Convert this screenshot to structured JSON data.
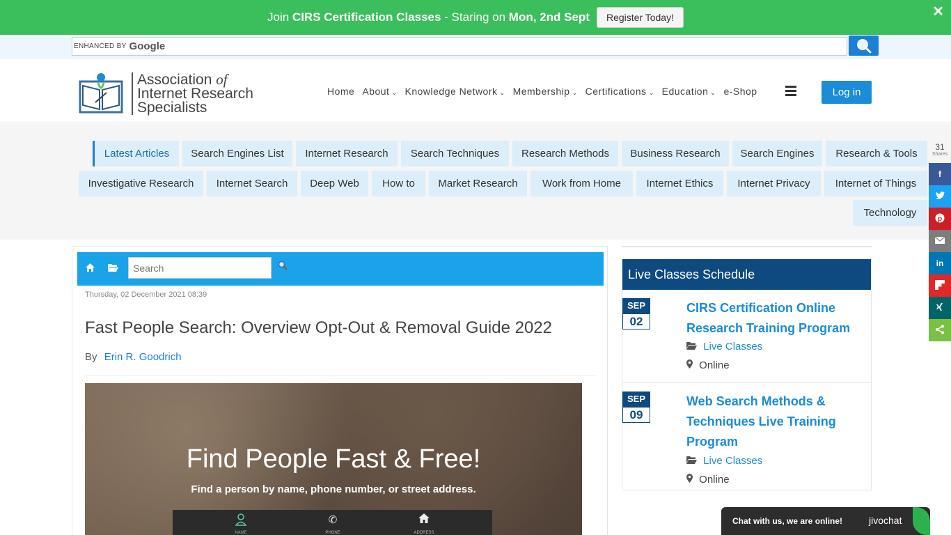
{
  "promo": {
    "prefix": "Join",
    "course": "CIRS Certification Classes",
    "mid": "- Staring on",
    "date": "Mon, 2nd Sept",
    "button": "Register Today!",
    "close": "✕"
  },
  "gsearch": {
    "enhanced": "ENHANCED BY",
    "brand": "Google"
  },
  "logo": {
    "line1a": "Association",
    "line1b": "of",
    "line2": "Internet Research",
    "line3": "Specialists"
  },
  "nav": {
    "items": [
      "Home",
      "About",
      "Knowledge Network",
      "Membership",
      "Certifications",
      "Education",
      "e-Shop"
    ],
    "login": "Log in"
  },
  "tags": [
    "Latest Articles",
    "Search Engines List",
    "Internet Research",
    "Search Techniques",
    "Research Methods",
    "Business Research",
    "Search Engines",
    "Research & Tools",
    "Investigative Research",
    "Internet Search",
    "Deep Web",
    "How to",
    "Market Research",
    "Work from Home",
    "Internet Ethics",
    "Internet Privacy",
    "Internet of Things",
    "Technology"
  ],
  "share": {
    "count": "31",
    "label": "Shares",
    "buttons": [
      {
        "name": "facebook",
        "glyph": "f",
        "color": "#3b5998"
      },
      {
        "name": "twitter",
        "glyph": "t",
        "color": "#1da1f2"
      },
      {
        "name": "pinterest",
        "glyph": "P",
        "color": "#cb2027"
      },
      {
        "name": "email",
        "glyph": "✉",
        "color": "#7d7d7d"
      },
      {
        "name": "linkedin",
        "glyph": "in",
        "color": "#0077b5"
      },
      {
        "name": "flipboard",
        "glyph": "F",
        "color": "#e12828"
      },
      {
        "name": "xing",
        "glyph": "X",
        "color": "#026466"
      },
      {
        "name": "share",
        "glyph": "<",
        "color": "#7ac143"
      }
    ]
  },
  "article": {
    "search_placeholder": "Search",
    "date": "Thursday, 02 December 2021 08:39",
    "title": "Fast People Search: Overview Opt-Out & Removal Guide 2022",
    "by": "By",
    "author": "Erin R. Goodrich",
    "hero": {
      "headline": "Find People Fast & Free!",
      "sub": "Find a person by name, phone number, or street address.",
      "tabs": [
        "NAME",
        "PHONE",
        "ADDRESS"
      ]
    }
  },
  "schedule": {
    "title": "Live Classes Schedule",
    "events": [
      {
        "month": "SEP",
        "day": "02",
        "title": "CIRS Certification Online Research Training Program",
        "category": "Live Classes",
        "location": "Online"
      },
      {
        "month": "SEP",
        "day": "09",
        "title": "Web Search Methods & Techniques Live Training Program",
        "category": "Live Classes",
        "location": "Online"
      }
    ]
  },
  "chat": {
    "text": "Chat with us, we are online!",
    "brand": "jivochat"
  }
}
